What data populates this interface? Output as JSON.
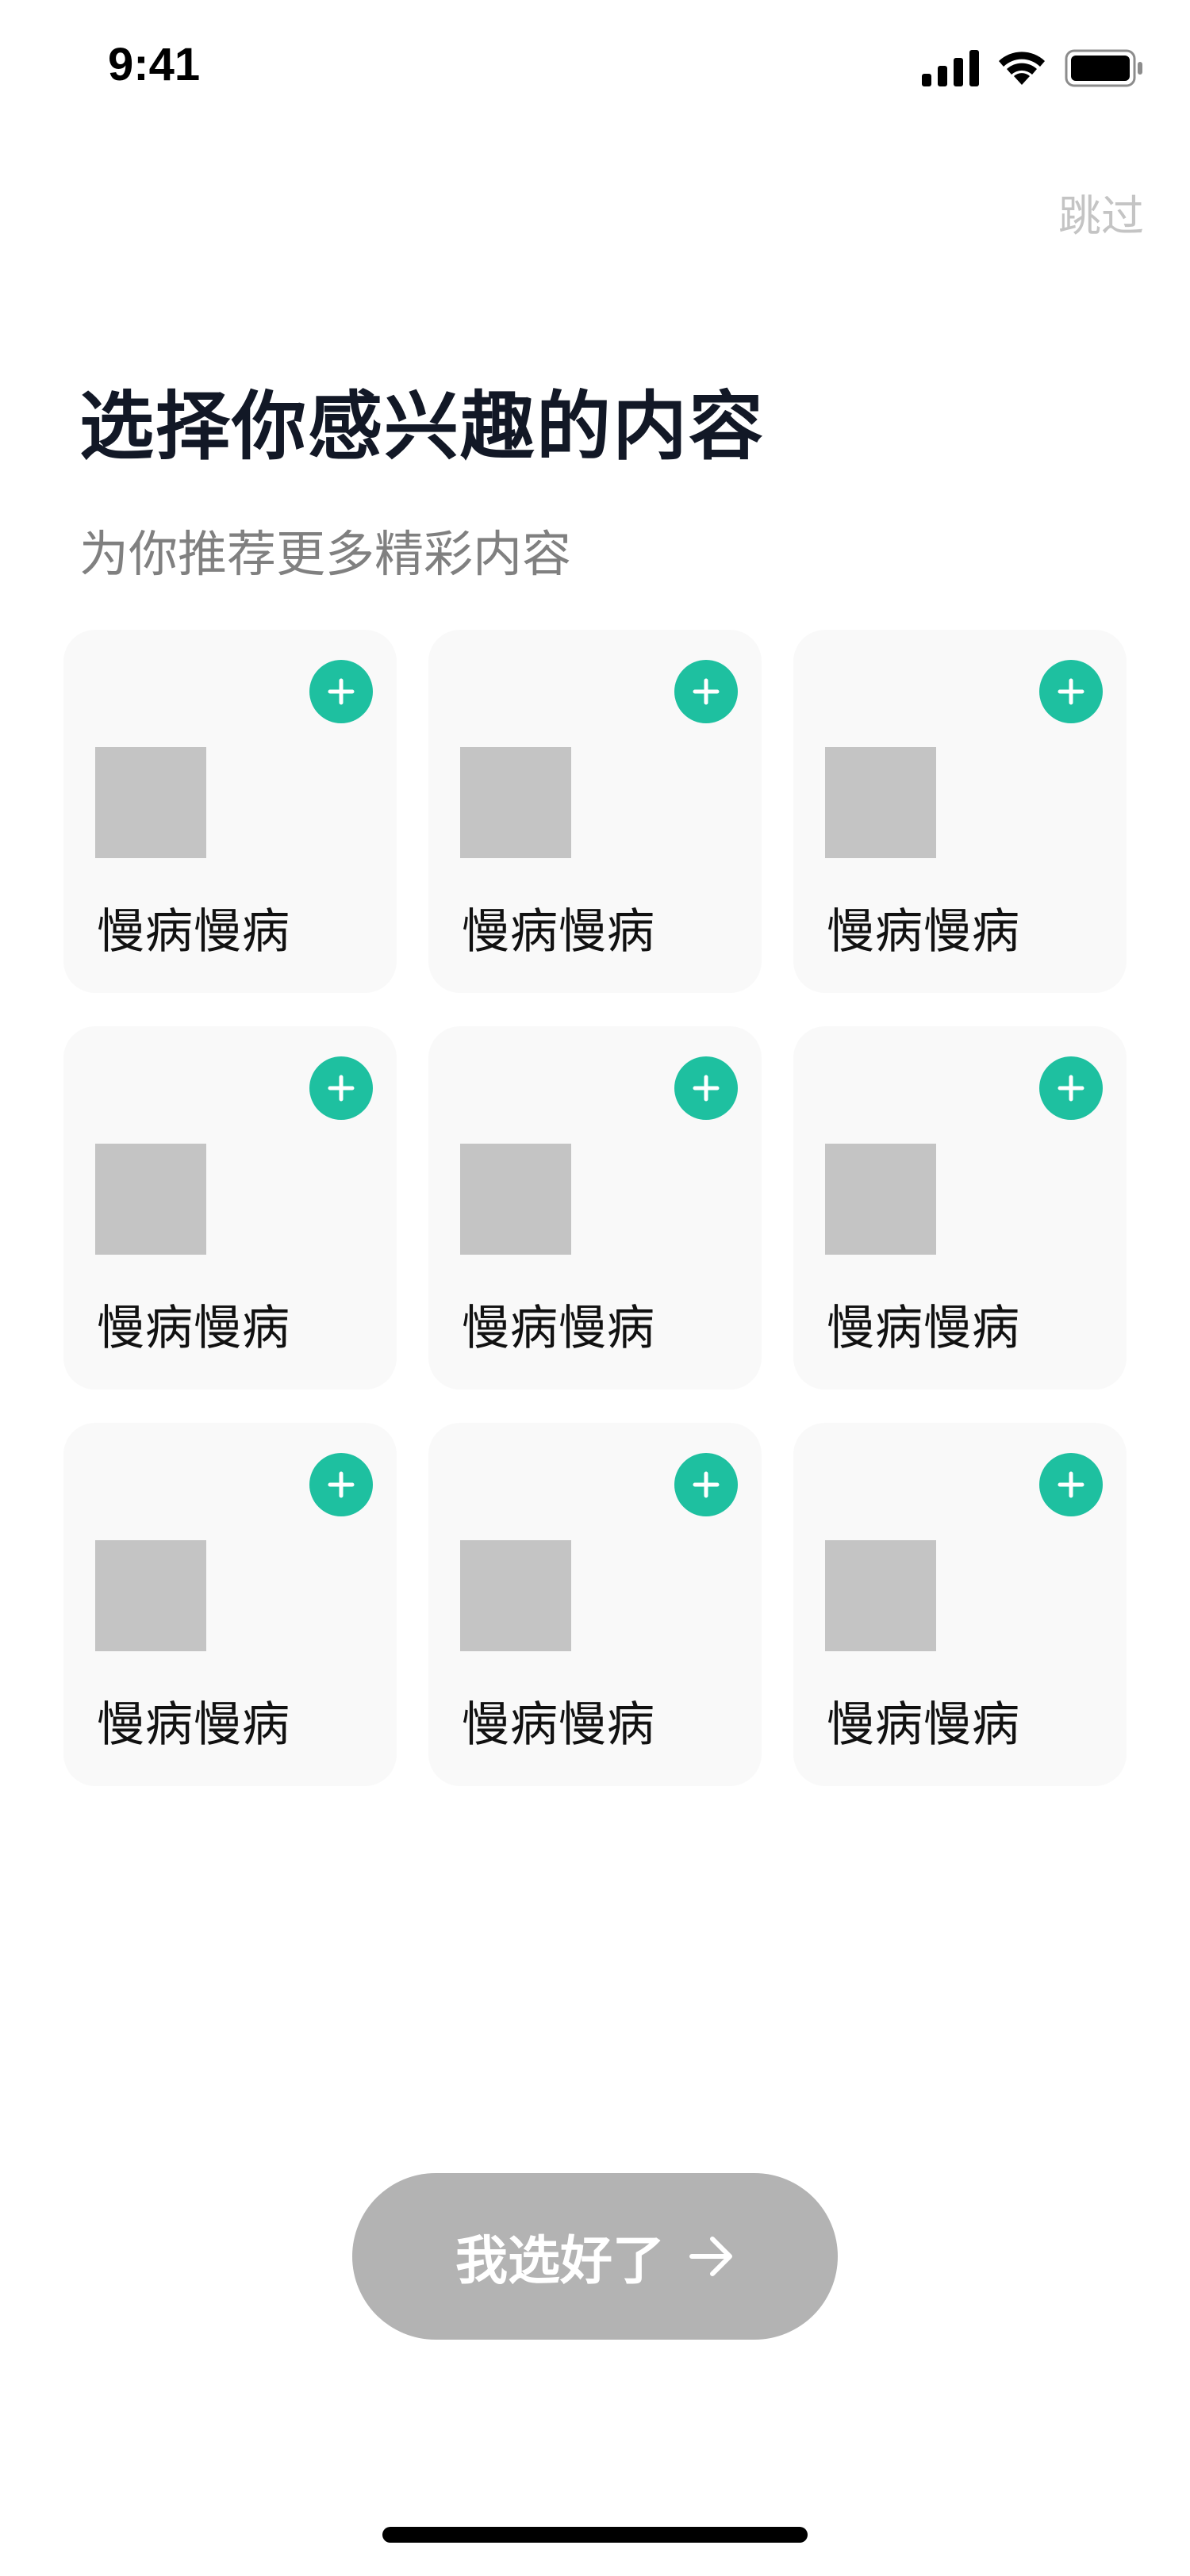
{
  "status_bar": {
    "time": "9:41"
  },
  "header": {
    "skip_label": "跳过"
  },
  "title": "选择你感兴趣的内容",
  "subtitle": "为你推荐更多精彩内容",
  "grid": {
    "items": [
      {
        "label": "慢病慢病",
        "selected": false
      },
      {
        "label": "慢病慢病",
        "selected": false
      },
      {
        "label": "慢病慢病",
        "selected": false
      },
      {
        "label": "慢病慢病",
        "selected": false
      },
      {
        "label": "慢病慢病",
        "selected": false
      },
      {
        "label": "慢病慢病",
        "selected": false
      },
      {
        "label": "慢病慢病",
        "selected": false
      },
      {
        "label": "慢病慢病",
        "selected": false
      },
      {
        "label": "慢病慢病",
        "selected": false
      }
    ]
  },
  "confirm_button": {
    "label": "我选好了",
    "icon": "arrow-right-icon",
    "enabled": false
  },
  "colors": {
    "accent": "#1EC0A0",
    "card_background": "#F9F9F9",
    "placeholder_image": "#C4C4C4",
    "button_disabled": "#B3B3B3",
    "skip_text": "#C4C4C4",
    "subtitle_text": "#808080"
  }
}
